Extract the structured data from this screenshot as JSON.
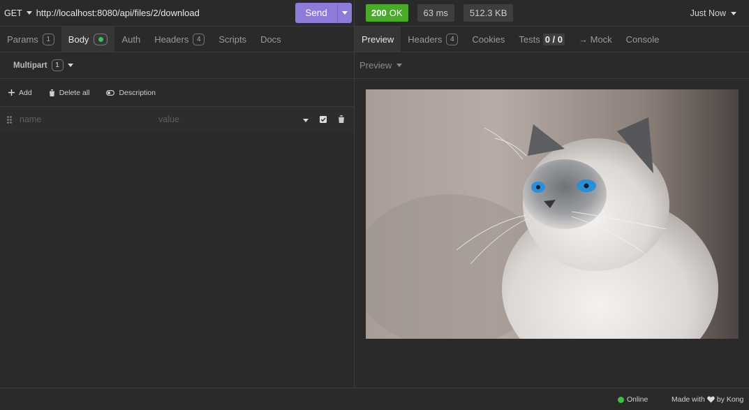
{
  "request": {
    "method": "GET",
    "url": "http://localhost:8080/api/files/2/download",
    "send_label": "Send"
  },
  "request_tabs": [
    {
      "label": "Params",
      "count": "1"
    },
    {
      "label": "Body"
    },
    {
      "label": "Auth"
    },
    {
      "label": "Headers",
      "count": "4"
    },
    {
      "label": "Scripts"
    },
    {
      "label": "Docs"
    }
  ],
  "body": {
    "type_label": "Multipart",
    "type_count": "1",
    "actions": {
      "add": "Add",
      "delete_all": "Delete all",
      "description": "Description"
    },
    "row": {
      "name_placeholder": "name",
      "value_placeholder": "value"
    }
  },
  "response": {
    "status_code": "200",
    "status_text": "OK",
    "time": "63 ms",
    "size": "512.3 KB",
    "when": "Just Now",
    "tabs": {
      "preview": "Preview",
      "headers": "Headers",
      "headers_count": "4",
      "cookies": "Cookies",
      "tests": "Tests",
      "tests_result": "0 / 0",
      "mock": "→ Mock",
      "console": "Console"
    },
    "preview_mode": "Preview"
  },
  "footer": {
    "online": "Online",
    "made_with": "Made with",
    "by": "by Kong"
  },
  "colors": {
    "accent": "#8e7ad8",
    "status_ok": "#4aaa2a",
    "online": "#3ec03e"
  }
}
